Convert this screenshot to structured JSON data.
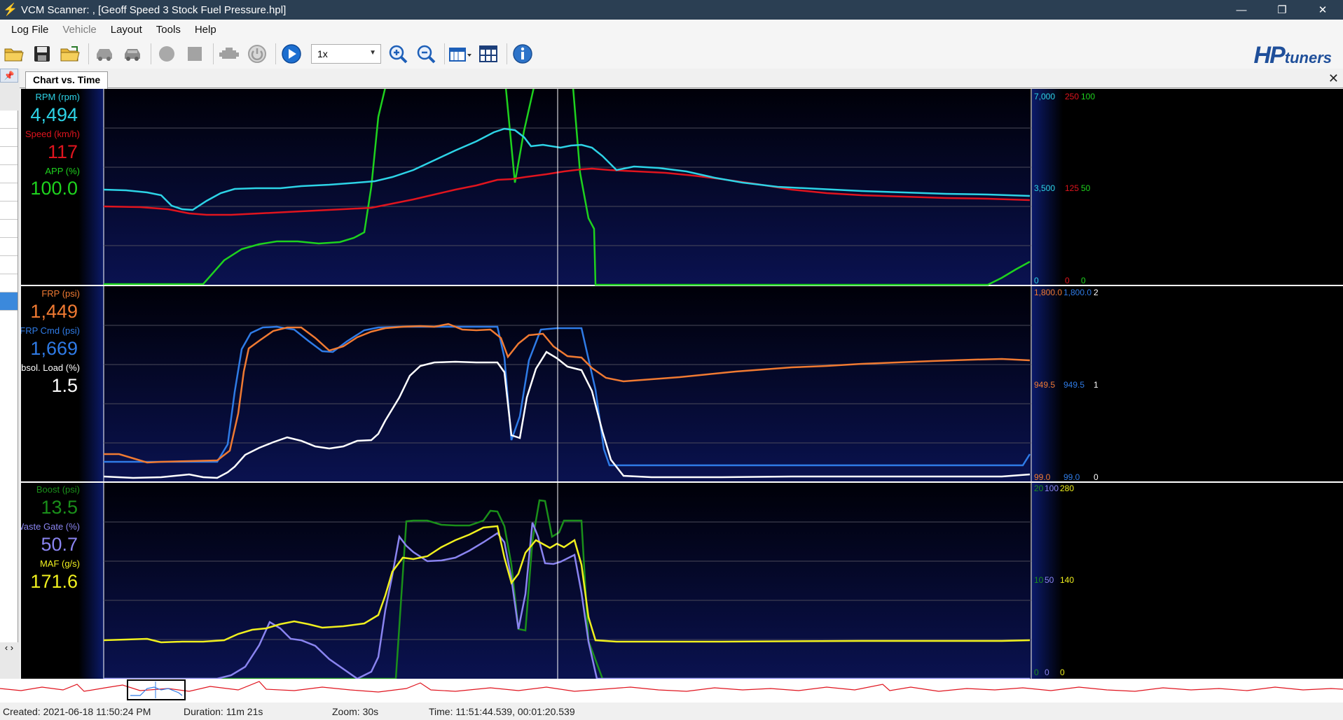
{
  "window": {
    "title": "VCM Scanner: ,  [Geoff Speed 3 Stock Fuel Pressure.hpl]",
    "minimize": "—",
    "maximize": "❐",
    "close": "✕"
  },
  "menu": [
    "Log File",
    "Vehicle",
    "Layout",
    "Tools",
    "Help"
  ],
  "toolbar": {
    "speed": "1x",
    "icons": [
      "open-folder-icon",
      "save-icon",
      "open-recent-icon",
      "vehicle-icon",
      "vehicle-connect-icon",
      "record-icon",
      "stop-icon",
      "engine-icon",
      "power-icon",
      "play-icon",
      "zoom-in-icon",
      "zoom-out-icon",
      "layout-icon",
      "grid-icon",
      "info-icon"
    ]
  },
  "logo": {
    "hp": "HP",
    "tuners": "tuners"
  },
  "tab": {
    "label": "Chart vs. Time",
    "close": "✕"
  },
  "panels": [
    {
      "channels": [
        {
          "name": "RPM (rpm)",
          "value": "4,494",
          "color": "#2dd3e6"
        },
        {
          "name": "Speed (km/h)",
          "value": "117",
          "color": "#e0141e"
        },
        {
          "name": "APP (%)",
          "value": "100.0",
          "color": "#1ed21e"
        }
      ],
      "scale_top": [
        "7,000",
        "250",
        "100"
      ],
      "scale_mid": [
        "3,500",
        "125",
        "50"
      ],
      "scale_bot": [
        "0",
        "0",
        "0"
      ]
    },
    {
      "channels": [
        {
          "name": "FRP (psi)",
          "value": "1,449",
          "color": "#f07a32"
        },
        {
          "name": "FRP  Cmd (psi)",
          "value": "1,669",
          "color": "#2f7be6"
        },
        {
          "name": "Absol. Load (%)",
          "value": "1.5",
          "color": "#ffffff"
        }
      ],
      "scale_top": [
        "1,800.0",
        "1,800.0",
        "2"
      ],
      "scale_mid": [
        "949.5",
        "949.5",
        "1"
      ],
      "scale_bot": [
        "99.0",
        "99.0",
        "0"
      ]
    },
    {
      "channels": [
        {
          "name": "Boost (psi)",
          "value": "13.5",
          "color": "#1a8f1a"
        },
        {
          "name": "Waste Gate (%)",
          "value": "50.7",
          "color": "#8a84f0"
        },
        {
          "name": "MAF (g/s)",
          "value": "171.6",
          "color": "#f0f01e"
        }
      ],
      "scale_top": [
        "20",
        "100",
        "280"
      ],
      "scale_mid": [
        "10",
        "50",
        "140"
      ],
      "scale_bot": [
        "0",
        "0",
        "0"
      ]
    }
  ],
  "status": {
    "created": "Created: 2021-06-18 11:50:24 PM",
    "duration": "Duration: 11m 21s",
    "zoom": "Zoom: 30s",
    "time": "Time: 11:51:44.539, 00:01:20.539"
  }
}
